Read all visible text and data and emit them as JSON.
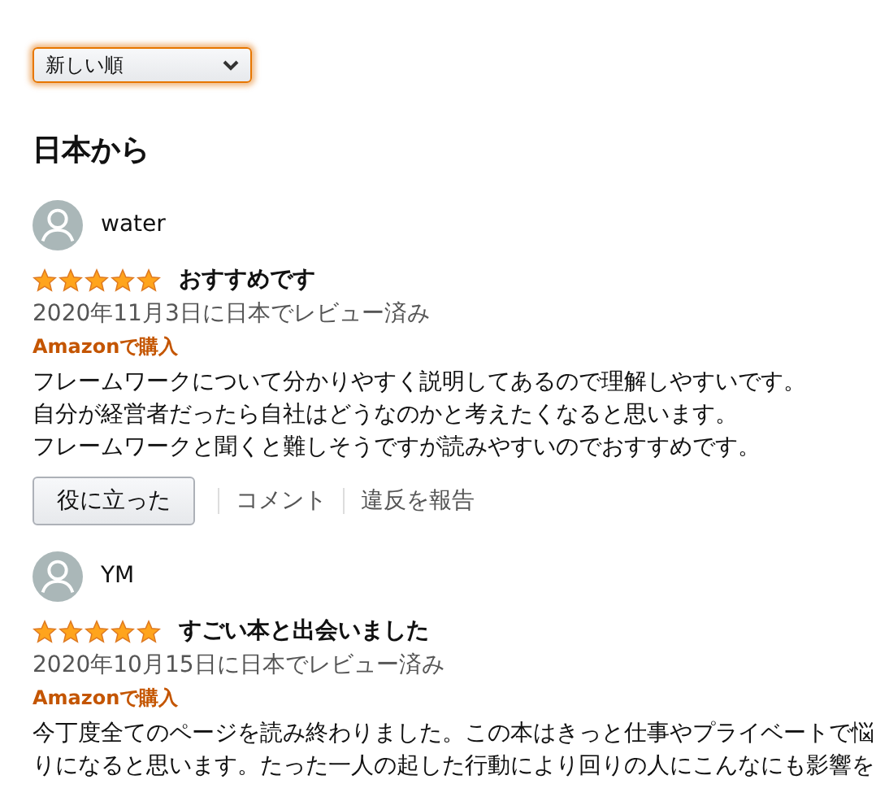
{
  "sort": {
    "value": "新しい順"
  },
  "section_title": "日本から",
  "reviews": [
    {
      "author": "water",
      "stars": 5,
      "title": "おすすめです",
      "date": "2020年11月3日に日本でレビュー済み",
      "badge": "Amazonで購入",
      "body": [
        "フレームワークについて分かりやすく説明してあるので理解しやすいです。",
        "自分が経営者だったら自社はどうなのかと考えたくなると思います。",
        "フレームワークと聞くと難しそうですが読みやすいのでおすすめです。"
      ],
      "actions": {
        "helpful": "役に立った",
        "comment": "コメント",
        "report": "違反を報告"
      }
    },
    {
      "author": "YM",
      "stars": 5,
      "title": "すごい本と出会いました",
      "date": "2020年10月15日に日本でレビュー済み",
      "badge": "Amazonで購入",
      "body": [
        "今丁度全てのページを読み終わりました。この本はきっと仕事やプライベートで悩",
        "りになると思います。たった一人の起した行動により回りの人にこんなにも影響を"
      ]
    }
  ]
}
